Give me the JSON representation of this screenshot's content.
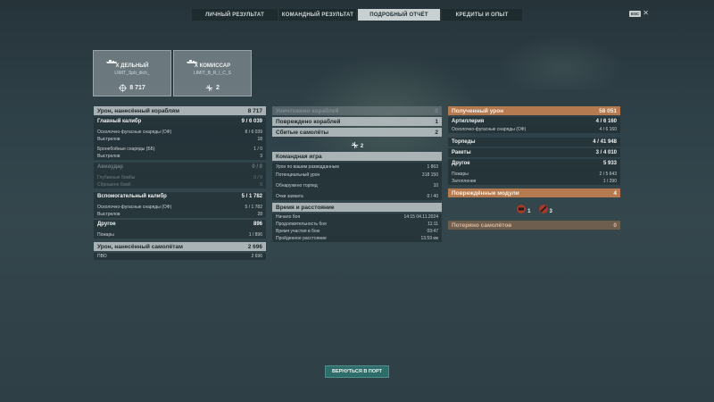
{
  "tabs": [
    "ЛИЧНЫЙ РЕЗУЛЬТАТ",
    "КОМАНДНЫЙ РЕЗУЛЬТАТ",
    "ПОДРОБНЫЙ ОТЧЁТ",
    "КРЕДИТЫ И ОПЫТ"
  ],
  "esc_label": "ESC",
  "ships": [
    {
      "name": "X ДЕЛЬНЫЙ",
      "tag": "LIMIT_Spb_dich_",
      "stat": "8 717"
    },
    {
      "name": "X КОМИССАР",
      "tag": "LIMIT_B_R_I_C_S",
      "stat": "2"
    }
  ],
  "left": {
    "damage_ships": {
      "label": "Урон, нанесённый кораблям",
      "value": "8 717"
    },
    "main_battery": {
      "label": "Главный калибр",
      "value": "9 / 6 039"
    },
    "he_main": {
      "label": "Осколочно-фугасные снаряды (ОФ)",
      "value": "8 / 6 039"
    },
    "shots_main": {
      "label": "Выстрелов",
      "value": "18"
    },
    "ap_main": {
      "label": "Бронебойные снаряды (ББ)",
      "value": "1 / 0"
    },
    "shots_ap": {
      "label": "Выстрелов",
      "value": "3"
    },
    "airstrike": {
      "label": "Авиаудар",
      "value": "0 / 0"
    },
    "depth_charges": {
      "label": "Глубинные бомбы",
      "value": "0 / 0"
    },
    "dropped_bombs": {
      "label": "Сброшено бомб",
      "value": "0"
    },
    "secondary": {
      "label": "Вспомогательный калибр",
      "value": "5 / 1 782"
    },
    "he_secondary": {
      "label": "Осколочно-фугасные снаряды (ОФ)",
      "value": "5 / 1 782"
    },
    "shots_secondary": {
      "label": "Выстрелов",
      "value": "28"
    },
    "other": {
      "label": "Другое",
      "value": "896"
    },
    "fires": {
      "label": "Пожары",
      "value": "1 / 896"
    },
    "damage_planes": {
      "label": "Урон, нанесённый самолётам",
      "value": "2 696"
    },
    "aa": {
      "label": "ПВО",
      "value": "2 696"
    }
  },
  "middle": {
    "destroyed": {
      "label": "Уничтожено кораблей",
      "value": "0"
    },
    "damaged": {
      "label": "Повреждено кораблей",
      "value": "1"
    },
    "planes_shot": {
      "label": "Сбитые самолёты",
      "value": "2"
    },
    "planes_icon_value": "2",
    "teamplay": {
      "label": "Командная игра"
    },
    "spotting_damage": {
      "label": "Урон по вашим разведданным",
      "value": "1 863"
    },
    "potential_damage": {
      "label": "Потенциальный урон",
      "value": "318 150"
    },
    "torpedoes_spotted": {
      "label": "Обнаружено торпед",
      "value": "10"
    },
    "capture_points": {
      "label": "Очки захвата",
      "value": "0 / 40"
    },
    "time_distance": {
      "label": "Время и расстояние"
    },
    "battle_start": {
      "label": "Начало боя",
      "value": "14:15  04.11.2024"
    },
    "battle_duration": {
      "label": "Продолжительность боя",
      "value": "11:11"
    },
    "time_in_battle": {
      "label": "Время участия в бою",
      "value": "03:47"
    },
    "distance": {
      "label": "Пройденное расстояние",
      "value": "13.59 км"
    }
  },
  "right": {
    "received": {
      "label": "Полученный урон",
      "value": "58 051"
    },
    "artillery": {
      "label": "Артиллерия",
      "value": "4 / 6 160"
    },
    "he_received": {
      "label": "Осколочно-фугасные снаряды (ОФ)",
      "value": "4 / 6 160"
    },
    "torpedoes": {
      "label": "Торпеды",
      "value": "4 / 41 948"
    },
    "rockets": {
      "label": "Ракеты",
      "value": "3 / 4 010"
    },
    "other": {
      "label": "Другое",
      "value": "5 933"
    },
    "fires": {
      "label": "Пожары",
      "value": "2 / 5 643"
    },
    "flooding": {
      "label": "Затопления",
      "value": "1 / 290"
    },
    "damaged_modules": {
      "label": "Повреждённые модули",
      "value": "4"
    },
    "module_1_count": "1",
    "module_2_count": "3",
    "lost_planes": {
      "label": "Потеряно самолётов",
      "value": "0"
    }
  },
  "return_button": "ВЕРНУТЬСЯ В ПОРТ"
}
